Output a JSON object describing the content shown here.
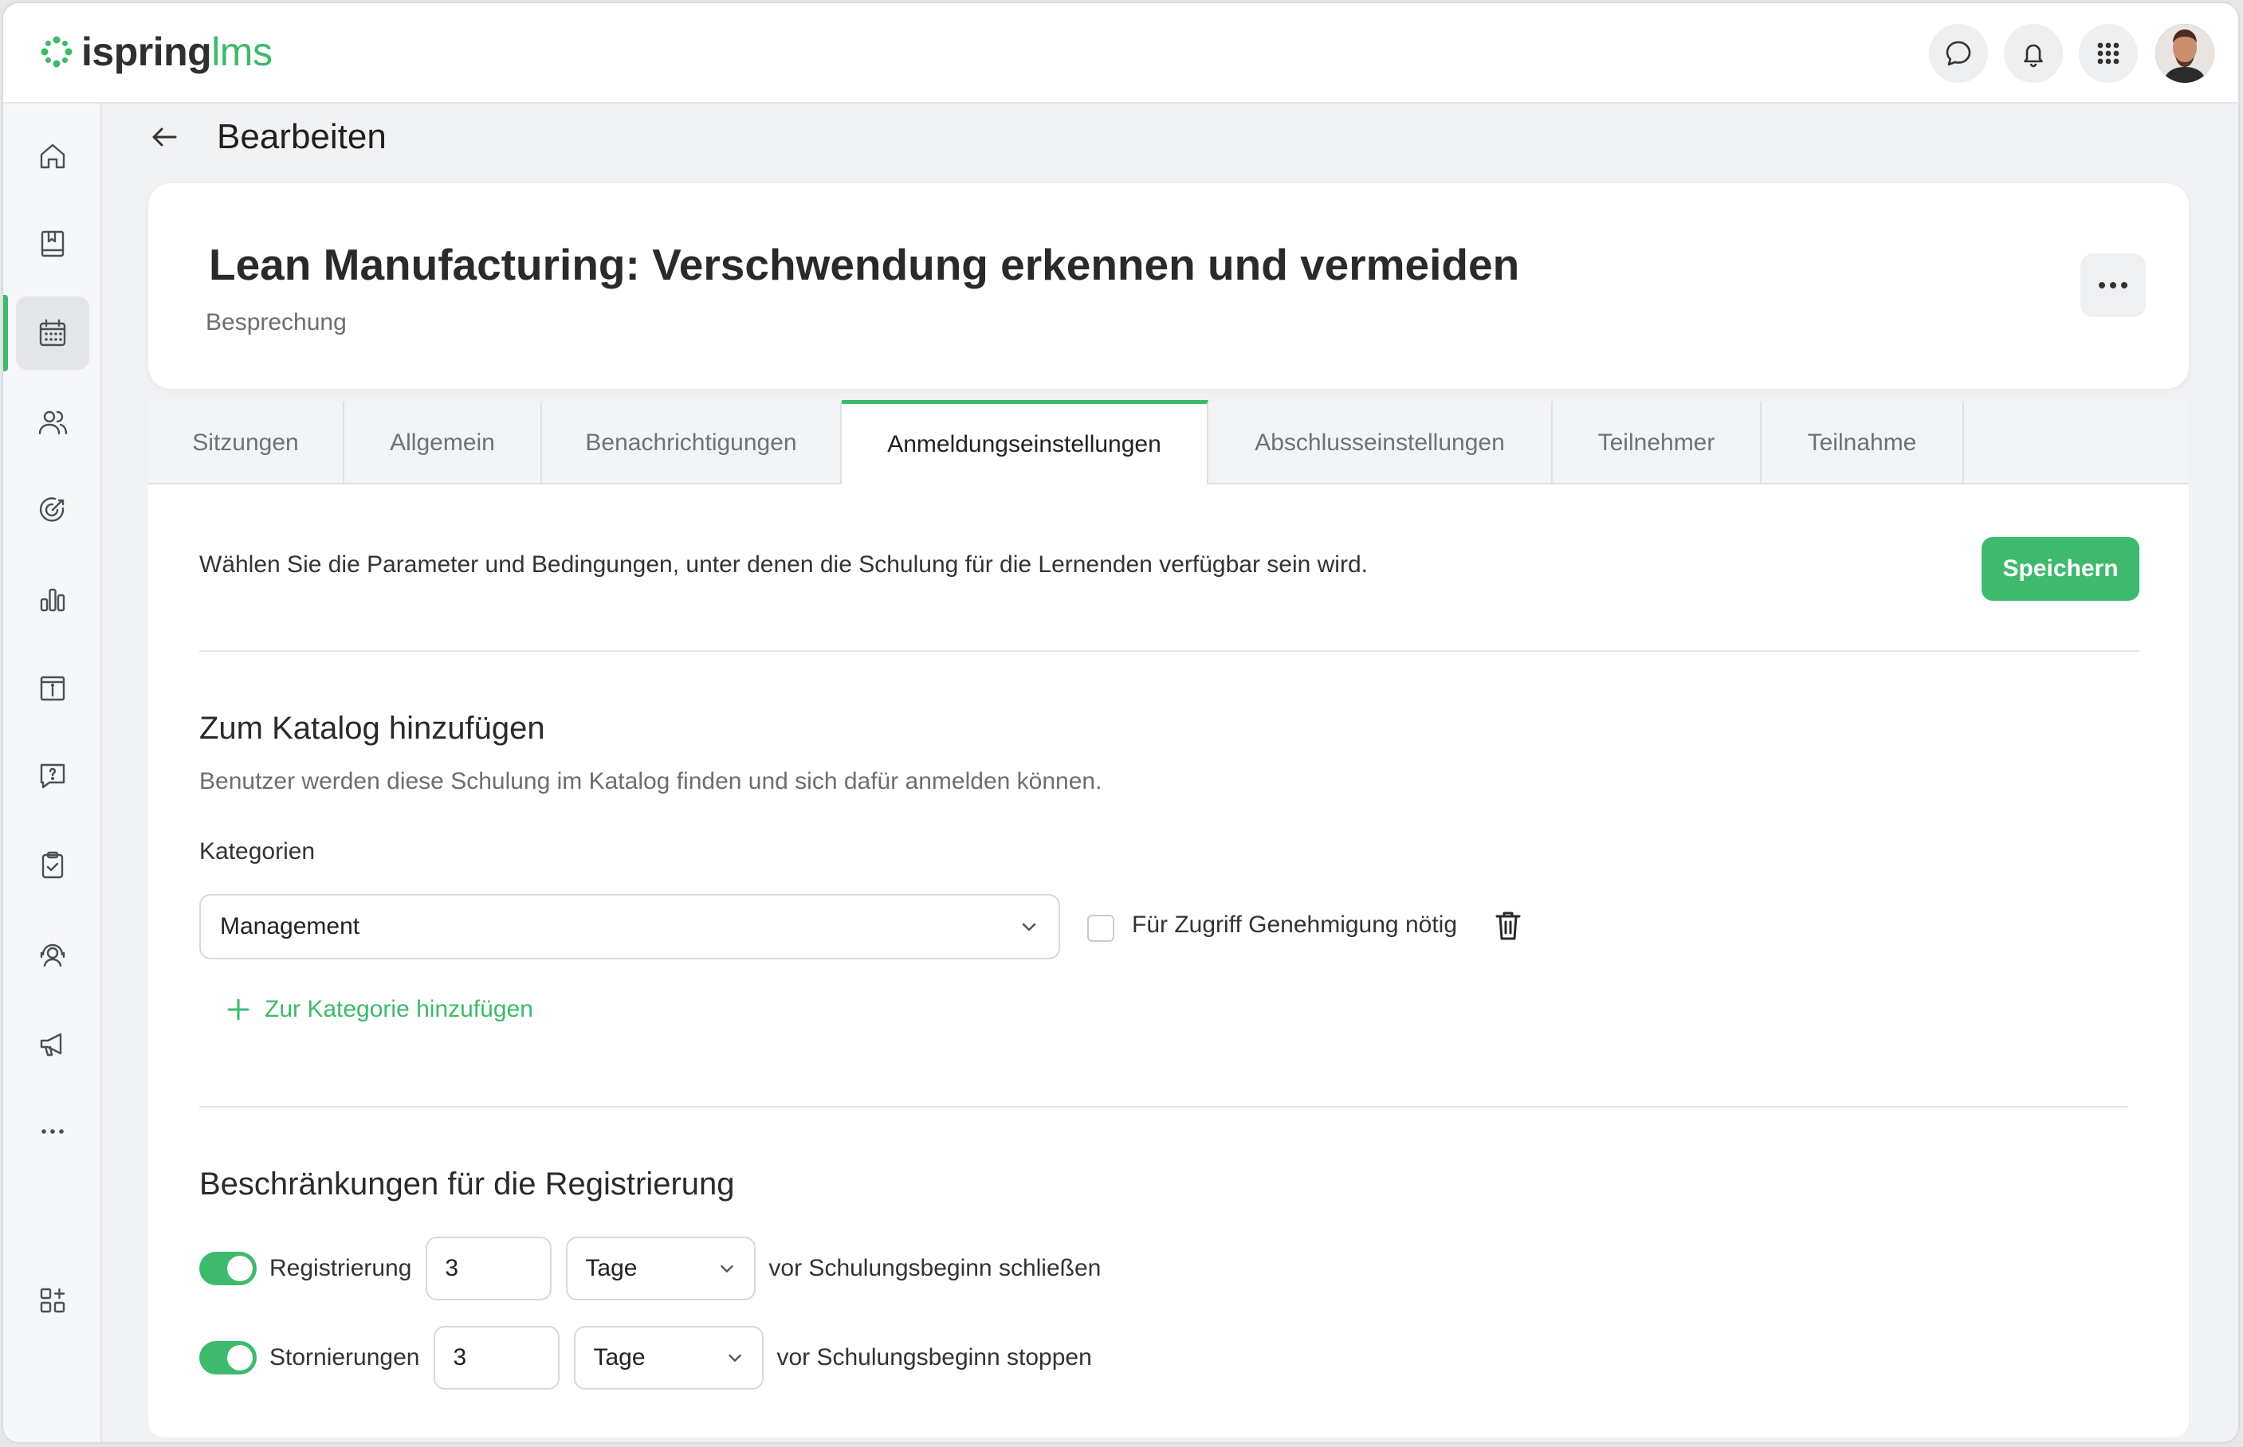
{
  "brand": {
    "name": "ispring",
    "suffix": "lms",
    "accent": "#3dba6c"
  },
  "topbar": {
    "icons": [
      "chat-icon",
      "bell-icon",
      "apps-grid-icon"
    ],
    "avatar": "user-avatar"
  },
  "sidebar": {
    "items": [
      "home-icon",
      "library-icon",
      "calendar-icon",
      "users-icon",
      "target-icon",
      "chart-icon",
      "info-icon",
      "help-chat-icon",
      "clipboard-check-icon",
      "support-agent-icon",
      "megaphone-icon",
      "more-icon",
      "add-widget-icon"
    ],
    "active": "calendar-icon"
  },
  "header": {
    "back_icon": "arrow-left-icon",
    "title": "Bearbeiten"
  },
  "course": {
    "title": "Lean Manufacturing: Verschwendung erkennen und vermeiden",
    "type": "Besprechung"
  },
  "tabs": [
    {
      "label": "Sitzungen"
    },
    {
      "label": "Allgemein"
    },
    {
      "label": "Benachrichtigungen"
    },
    {
      "label": "Anmeldungseinstellungen",
      "active": true
    },
    {
      "label": "Abschlusseinstellungen"
    },
    {
      "label": "Teilnehmer"
    },
    {
      "label": "Teilnahme"
    }
  ],
  "enrollment": {
    "description": "Wählen Sie die Parameter und Bedingungen, unter denen die Schulung für die Lernenden verfügbar sein wird.",
    "save_label": "Speichern",
    "catalog": {
      "title": "Zum Katalog hinzufügen",
      "subtitle": "Benutzer werden diese Schulung im Katalog finden und sich dafür anmelden können.",
      "categories_label": "Kategorien",
      "category_value": "Management",
      "approval_label": "Für Zugriff Genehmigung nötig",
      "approval_checked": false,
      "add_category_label": "Zur Kategorie hinzufügen"
    },
    "restrictions": {
      "title": "Beschränkungen für die Registrierung",
      "rows": [
        {
          "label": "Registrierung",
          "enabled": true,
          "value": "3",
          "unit": "Tage",
          "suffix": "vor Schulungsbeginn schließen"
        },
        {
          "label": "Stornierungen",
          "enabled": true,
          "value": "3",
          "unit": "Tage",
          "suffix": "vor Schulungsbeginn stoppen"
        }
      ]
    }
  }
}
